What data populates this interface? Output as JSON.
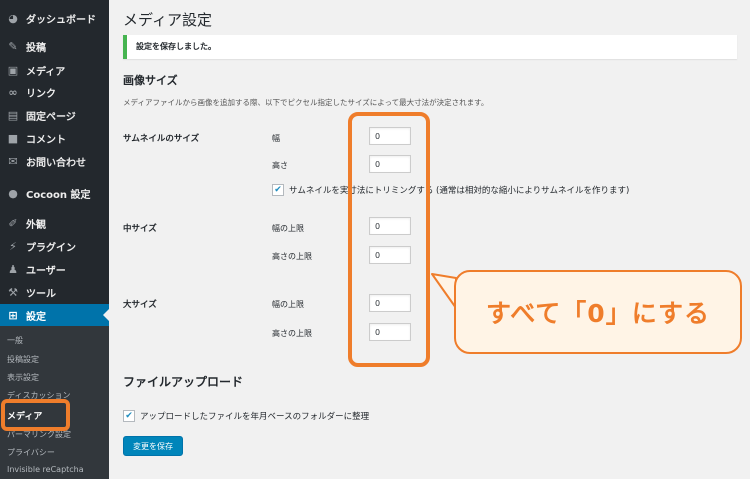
{
  "sidebar": {
    "items": [
      {
        "label": "ダッシュボード",
        "icon": "dashboard-icon",
        "glyph": "◕"
      },
      {
        "label": "投稿",
        "icon": "pin-icon",
        "glyph": "✎"
      },
      {
        "label": "メディア",
        "icon": "media-icon",
        "glyph": "▣"
      },
      {
        "label": "リンク",
        "icon": "link-icon",
        "glyph": "∞"
      },
      {
        "label": "固定ページ",
        "icon": "page-icon",
        "glyph": "▤"
      },
      {
        "label": "コメント",
        "icon": "comment-icon",
        "glyph": "■"
      },
      {
        "label": "お問い合わせ",
        "icon": "mail-icon",
        "glyph": "✉"
      },
      {
        "label": "Cocoon 設定",
        "icon": "cocoon-icon",
        "glyph": "●"
      },
      {
        "label": "外観",
        "icon": "appearance-icon",
        "glyph": "✐"
      },
      {
        "label": "プラグイン",
        "icon": "plugin-icon",
        "glyph": "⚡"
      },
      {
        "label": "ユーザー",
        "icon": "user-icon",
        "glyph": "♟"
      },
      {
        "label": "ツール",
        "icon": "tool-icon",
        "glyph": "⚒"
      },
      {
        "label": "設定",
        "icon": "settings-icon",
        "glyph": "⊞"
      }
    ],
    "submenu": [
      {
        "label": "一般"
      },
      {
        "label": "投稿設定"
      },
      {
        "label": "表示設定"
      },
      {
        "label": "ディスカッション"
      },
      {
        "label": "メディア"
      },
      {
        "label": "パーマリンク設定"
      },
      {
        "label": "プライバシー"
      },
      {
        "label": "Invisible reCaptcha"
      }
    ]
  },
  "page": {
    "title": "メディア設定",
    "notice": "設定を保存しました。",
    "image_sizes_heading": "画像サイズ",
    "image_sizes_desc": "メディアファイルから画像を追加する際、以下でピクセル指定したサイズによって最大寸法が決定されます。",
    "thumbnail": {
      "label": "サムネイルのサイズ",
      "width_label": "幅",
      "width_value": "0",
      "height_label": "高さ",
      "height_value": "0",
      "crop_label": "サムネイルを実寸法にトリミングする (通常は相対的な縮小によりサムネイルを作ります)",
      "crop_checked": true
    },
    "medium": {
      "label": "中サイズ",
      "max_width_label": "幅の上限",
      "max_width_value": "0",
      "max_height_label": "高さの上限",
      "max_height_value": "0"
    },
    "large": {
      "label": "大サイズ",
      "max_width_label": "幅の上限",
      "max_width_value": "0",
      "max_height_label": "高さの上限",
      "max_height_value": "0"
    },
    "upload_heading": "ファイルアップロード",
    "upload_checkbox_label": "アップロードしたファイルを年月ベースのフォルダーに整理",
    "upload_checked": true,
    "save_button": "変更を保存"
  },
  "annotation": {
    "callout": "すべて「0」にする",
    "accent_color": "#ef7d2b"
  }
}
